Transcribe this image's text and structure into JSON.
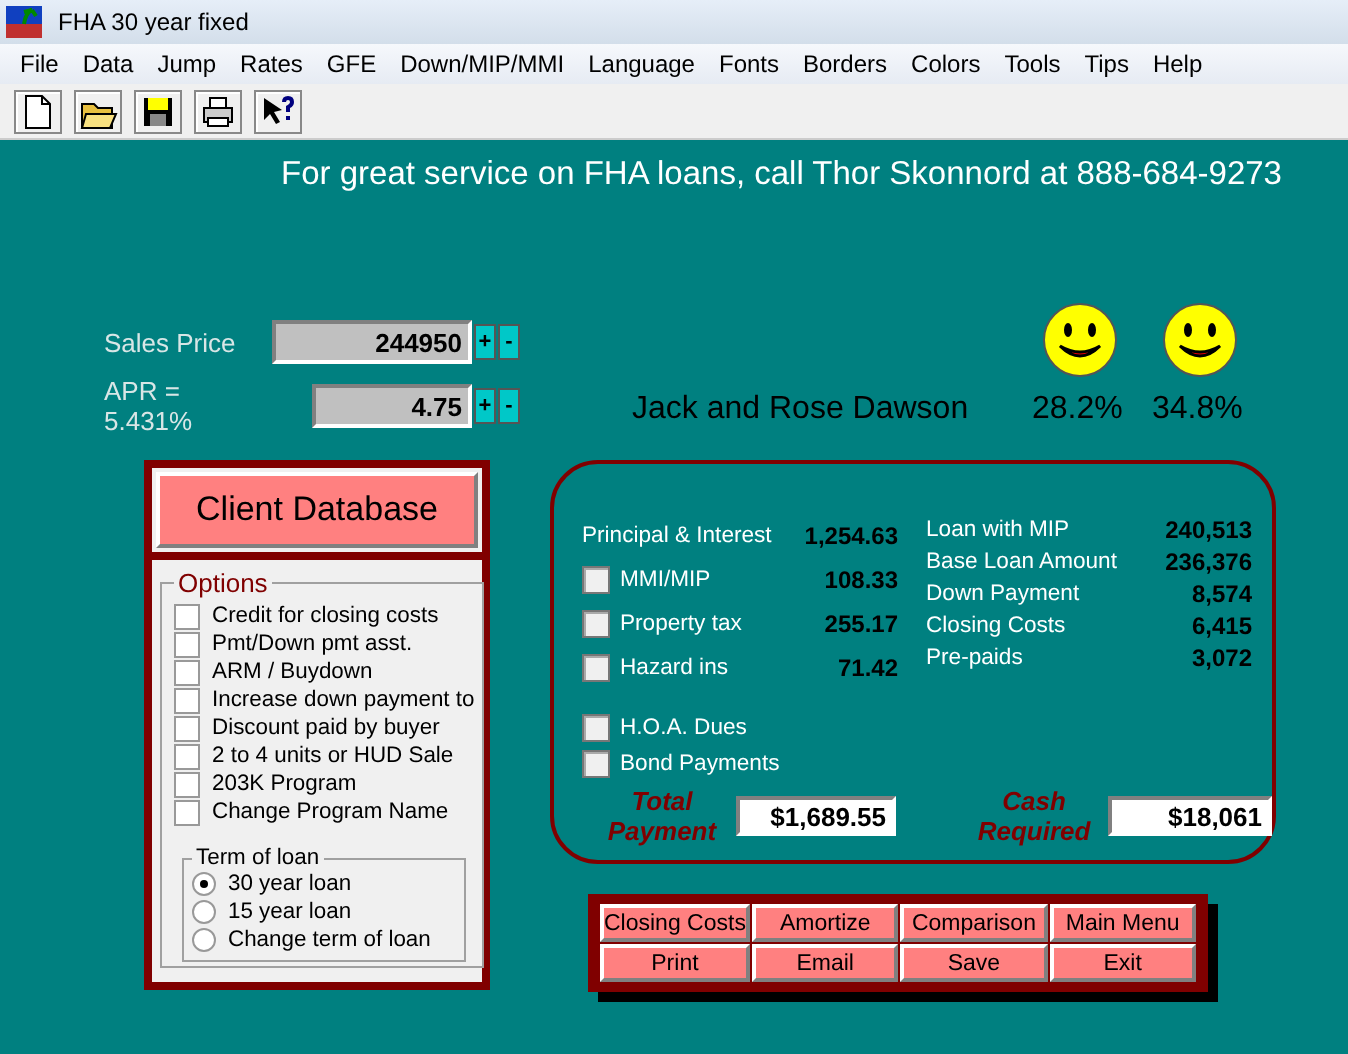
{
  "window": {
    "title": "FHA 30 year fixed"
  },
  "menu": [
    "File",
    "Data",
    "Jump",
    "Rates",
    "GFE",
    "Down/MIP/MMI",
    "Language",
    "Fonts",
    "Borders",
    "Colors",
    "Tools",
    "Tips",
    "Help"
  ],
  "banner": "For great service on FHA loans, call Thor Skonnord at 888-684-9273",
  "inputs": [
    {
      "label": "Sales Price",
      "value": "244950",
      "buttons": [
        "+",
        "-"
      ]
    },
    {
      "label": "APR = 5.431%",
      "value": "4.75",
      "buttons": [
        "+",
        "-"
      ]
    }
  ],
  "client": {
    "name": "Jack and Rose Dawson",
    "ratios": [
      "28.2%",
      "34.8%"
    ]
  },
  "database_button": "Client Database",
  "options": {
    "title": "Options",
    "items": [
      {
        "label": "Credit for closing costs",
        "checked": false
      },
      {
        "label": "Pmt/Down pmt asst.",
        "checked": false
      },
      {
        "label": "ARM / Buydown",
        "checked": false
      },
      {
        "label": "Increase down payment to",
        "checked": false
      },
      {
        "label": "Discount paid by buyer",
        "checked": false
      },
      {
        "label": "2 to 4 units or HUD Sale",
        "checked": false
      },
      {
        "label": "203K Program",
        "checked": false
      },
      {
        "label": "Change Program Name",
        "checked": false
      }
    ]
  },
  "term": {
    "title": "Term of loan",
    "choices": [
      {
        "label": "30 year loan",
        "selected": true
      },
      {
        "label": "15 year loan",
        "selected": false
      },
      {
        "label": "Change term of loan",
        "selected": false
      }
    ]
  },
  "payment": {
    "rows": [
      {
        "kind": "plain",
        "label": "Principal & Interest",
        "value": "1,254.63"
      },
      {
        "kind": "check",
        "label": "MMI/MIP",
        "value": "108.33",
        "checked": false
      },
      {
        "kind": "check",
        "label": "Property tax",
        "value": "255.17",
        "checked": false
      },
      {
        "kind": "check",
        "label": "Hazard ins",
        "value": "71.42",
        "checked": false
      }
    ],
    "extras": [
      {
        "label": "H.O.A. Dues",
        "checked": false
      },
      {
        "label": "Bond Payments",
        "checked": false
      }
    ],
    "total_label": "Total Payment",
    "total": "$1,689.55"
  },
  "loan": {
    "rows": [
      {
        "label": "Loan with MIP",
        "value": "240,513"
      },
      {
        "label": "Base Loan Amount",
        "value": "236,376"
      },
      {
        "label": "Down Payment",
        "value": "8,574"
      },
      {
        "label": "Closing Costs",
        "value": "6,415"
      },
      {
        "label": "Pre-paids",
        "value": "3,072"
      }
    ],
    "cash_label": "Cash Required",
    "cash": "$18,061"
  },
  "actions": [
    "Closing Costs",
    "Amortize",
    "Comparison",
    "Main Menu",
    "Print",
    "Email",
    "Save",
    "Exit"
  ]
}
